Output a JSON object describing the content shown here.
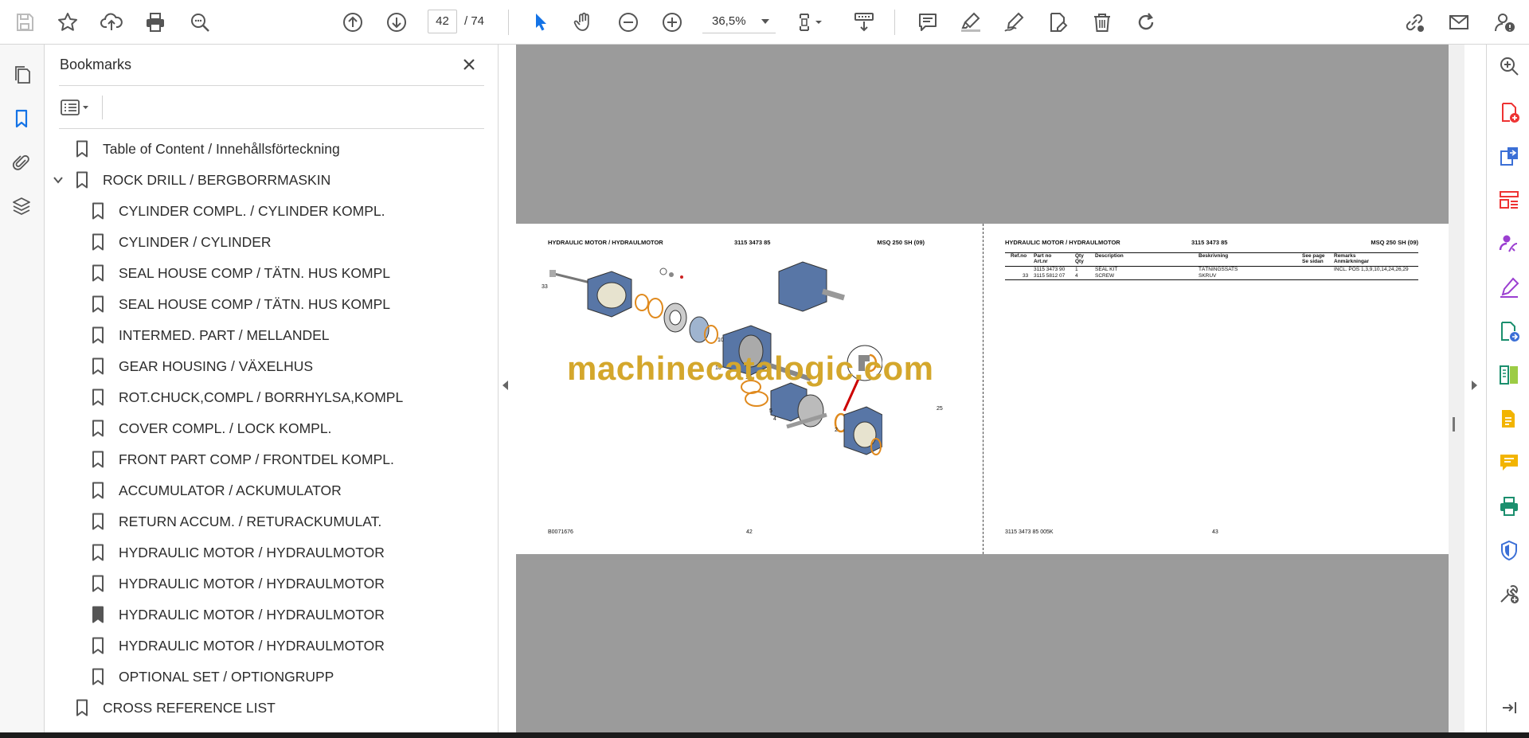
{
  "toolbar": {
    "page_current": "42",
    "page_total_label": "/  74",
    "zoom": "36,5%",
    "icons": [
      "save-icon",
      "star-icon",
      "upload-icon",
      "print-icon",
      "find-icon",
      "prev-page-icon",
      "next-page-icon",
      "select-cursor-icon",
      "hand-icon",
      "zoom-out-icon",
      "zoom-in-icon",
      "page-fit-icon",
      "scroll-mode-icon",
      "comment-icon",
      "highlight-icon",
      "draw-icon",
      "fill-sign-icon",
      "delete-icon",
      "rotate-icon",
      "share-link-icon",
      "email-icon",
      "account-icon"
    ]
  },
  "bookmarks_panel": {
    "title": "Bookmarks",
    "items": [
      {
        "label": "Table of Content / Innehållsförteckning",
        "level": 0
      },
      {
        "label": "ROCK DRILL / BERGBORRMASKIN",
        "level": 0,
        "expanded": true
      },
      {
        "label": "CYLINDER COMPL.  / CYLINDER KOMPL.",
        "level": 1
      },
      {
        "label": "CYLINDER / CYLINDER",
        "level": 1
      },
      {
        "label": "SEAL HOUSE COMP  / TÄTN. HUS KOMPL",
        "level": 1
      },
      {
        "label": "SEAL HOUSE COMP  / TÄTN. HUS KOMPL",
        "level": 1
      },
      {
        "label": "INTERMED. PART / MELLANDEL",
        "level": 1
      },
      {
        "label": "GEAR HOUSING / VÄXELHUS",
        "level": 1
      },
      {
        "label": "ROT.CHUCK,COMPL  / BORRHYLSA,KOMPL",
        "level": 1
      },
      {
        "label": "COVER COMPL. / LOCK KOMPL.",
        "level": 1
      },
      {
        "label": "FRONT PART COMP  / FRONTDEL KOMPL.",
        "level": 1
      },
      {
        "label": "ACCUMULATOR / ACKUMULATOR",
        "level": 1
      },
      {
        "label": "RETURN ACCUM. / RETURACKUMULAT.",
        "level": 1
      },
      {
        "label": "HYDRAULIC MOTOR  / HYDRAULMOTOR",
        "level": 1
      },
      {
        "label": "HYDRAULIC MOTOR  / HYDRAULMOTOR",
        "level": 1
      },
      {
        "label": "HYDRAULIC MOTOR  / HYDRAULMOTOR",
        "level": 1,
        "current": true
      },
      {
        "label": "HYDRAULIC MOTOR  / HYDRAULMOTOR",
        "level": 1
      },
      {
        "label": "OPTIONAL SET / OPTIONGRUPP",
        "level": 1
      },
      {
        "label": "CROSS REFERENCE LIST",
        "level": 0
      }
    ]
  },
  "document": {
    "watermark": "machinecatalogic.com",
    "left_page": {
      "header_title": "HYDRAULIC MOTOR / HYDRAULMOTOR",
      "header_partno": "3115 3473 85",
      "header_model": "MSQ 250 SH (09)",
      "footer_left": "B0071676",
      "footer_page": "42",
      "callouts": [
        "33",
        "10",
        "10",
        "10",
        "5",
        "4",
        "2",
        "25"
      ]
    },
    "right_page": {
      "header_title": "HYDRAULIC MOTOR / HYDRAULMOTOR",
      "header_partno": "3115 3473 85",
      "header_model": "MSQ 250 SH (09)",
      "footer_left": "3115 3473 85 005K",
      "footer_page": "43",
      "table": {
        "headers": [
          [
            "Ref.no",
            ""
          ],
          [
            "Part no",
            "Art.nr"
          ],
          [
            "Qty",
            "Qty"
          ],
          [
            "Description",
            ""
          ],
          [
            "Beskrivning",
            ""
          ],
          [
            "See page",
            "Se sidan"
          ],
          [
            "Remarks",
            "Anmärkningar"
          ]
        ],
        "rows": [
          [
            "",
            "3115 3473 90",
            "1",
            "SEAL KIT",
            "TÄTNINGSSATS",
            "",
            "INCL. POS 1,3,9,10,14,24,26,29"
          ],
          [
            "33",
            "3115 5812 07",
            "4",
            "SCREW",
            "SKRUV",
            "",
            ""
          ]
        ]
      }
    }
  },
  "colors": {
    "accent_blue": "#1473e6",
    "watermark": "#d4a72c",
    "viewer_gray": "#9b9b9b"
  }
}
